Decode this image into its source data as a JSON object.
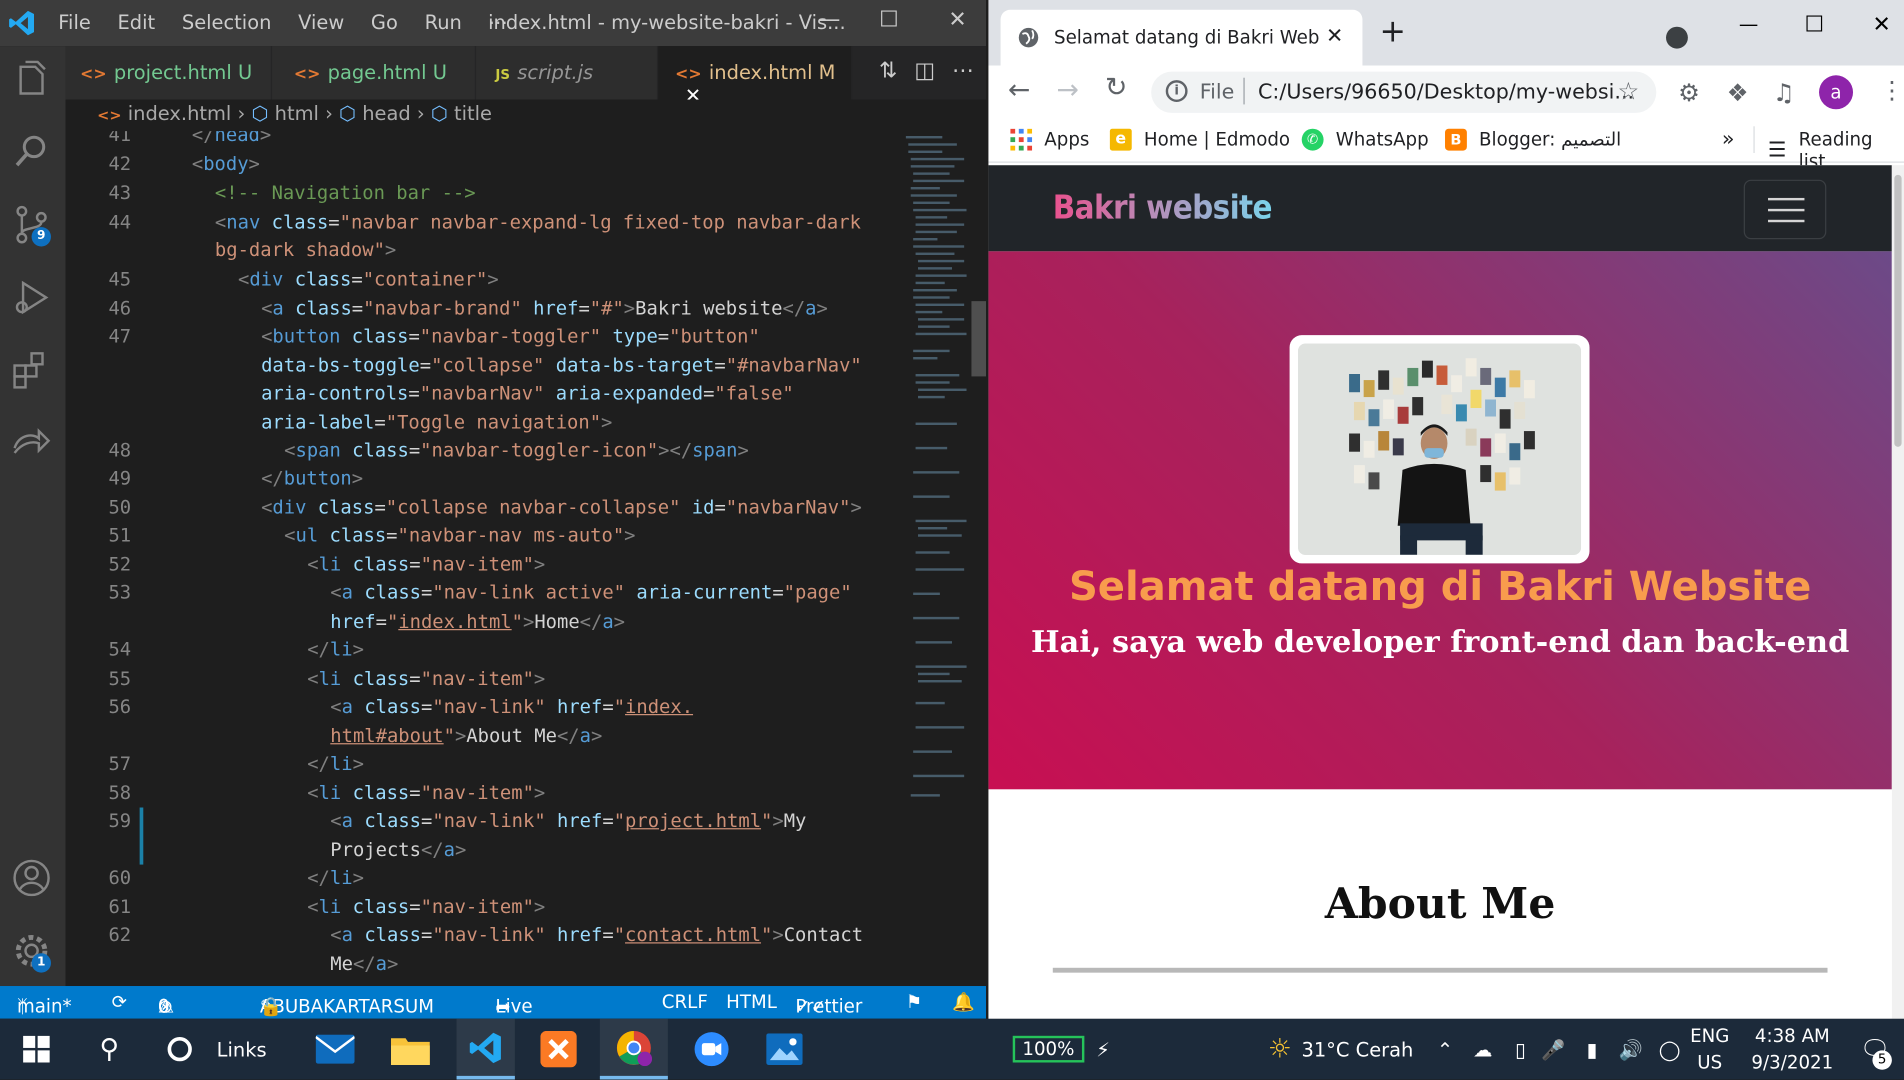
{
  "vscode": {
    "menu": [
      "File",
      "Edit",
      "Selection",
      "View",
      "Go",
      "Run",
      "⋯"
    ],
    "window_title": "index.html - my-website-bakri - Vis...",
    "activity_badges": {
      "source_control": "9",
      "settings": "1"
    },
    "tabs": [
      {
        "icon": "<>",
        "name": "project.html",
        "status": "U"
      },
      {
        "icon": "<>",
        "name": "page.html",
        "status": "U"
      },
      {
        "icon": "JS",
        "name": "script.js",
        "status": ""
      },
      {
        "icon": "<>",
        "name": "index.html",
        "status": "M",
        "close": "✕"
      }
    ],
    "breadcrumb": [
      "index.html",
      "html",
      "head",
      "title"
    ],
    "line_numbers": [
      "41",
      "42",
      "43",
      "44",
      "45",
      "46",
      "47",
      "48",
      "49",
      "50",
      "51",
      "52",
      "53",
      "54",
      "55",
      "56",
      "57",
      "58",
      "59",
      "60",
      "61",
      "62"
    ],
    "status_bar": {
      "branch": "main*",
      "errors": "0",
      "warnings": "0",
      "user": "ABUBAKARTARSUM",
      "live_share": "Live Share",
      "eol": "CRLF",
      "language": "HTML",
      "formatter": "Prettier"
    }
  },
  "chrome": {
    "tab_title": "Selamat datang di Bakri Web",
    "address_scheme": "File",
    "address_url": "C:/Users/96650/Desktop/my-websi...",
    "avatar_letter": "a",
    "bookmarks": [
      "Apps",
      "Home | Edmodo",
      "WhatsApp",
      "Blogger: التصميم"
    ],
    "bookmarks_overflow": "»",
    "reading_list": "Reading list",
    "page": {
      "brand": "Bakri website",
      "hero_title": "Selamat datang di Bakri Website",
      "hero_subtitle": "Hai, saya web developer front-end dan back-end",
      "section_title": "About Me"
    }
  },
  "taskbar": {
    "search_label": "Links",
    "battery": "100%",
    "weather": "31°C  Cerah",
    "language": "ENG",
    "region": "US",
    "time": "4:38 AM",
    "date": "9/3/2021",
    "notification_count": "5"
  }
}
